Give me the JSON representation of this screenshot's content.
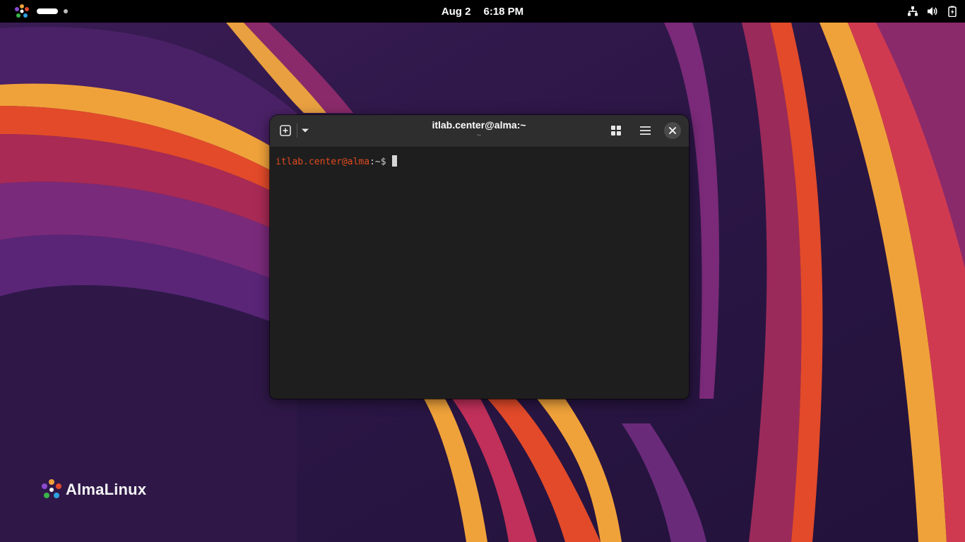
{
  "topbar": {
    "date": "Aug 2",
    "time": "6:18 PM",
    "tray_icons": [
      "network-wired-icon",
      "volume-icon",
      "battery-icon"
    ]
  },
  "window": {
    "title": "itlab.center@alma:~",
    "subtitle": "~",
    "terminal": {
      "prompt_user": "itlab.center@alma",
      "prompt_path": ":~$ ",
      "input": ""
    }
  },
  "brand": {
    "name": "AlmaLinux"
  },
  "colors": {
    "prompt_user": "#e24a1f",
    "terminal_bg": "#1e1e1e",
    "headerbar_bg": "#2e2e2e",
    "topbar_bg": "#000000"
  }
}
